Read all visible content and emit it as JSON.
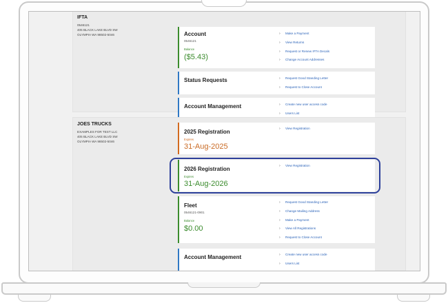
{
  "ifta": {
    "name": "IFTA",
    "lines": [
      "0546121",
      "405 BLACK LAKE BLVD SW",
      "OLYMPIA WA 98502-5046"
    ],
    "account": {
      "title": "Account",
      "number": "0546121",
      "balance_label": "Balance",
      "balance": "($5.43)",
      "links": [
        "Make a Payment",
        "View Returns",
        "Request or Renew IFTA Decals",
        "Change Account Addresses"
      ]
    },
    "status": {
      "title": "Status Requests",
      "links": [
        "Request Good Standing Letter",
        "Request to Close Account"
      ]
    },
    "management": {
      "title": "Account Management",
      "links": [
        "Create new user access code",
        "Users List"
      ]
    }
  },
  "joes": {
    "name": "JOES TRUCKS",
    "lines": [
      "EXAMPLES FOR TEST LLC",
      "405 BLACK LAKE BLVD SW",
      "OLYMPIA WA 98502-5046"
    ],
    "reg2025": {
      "title": "2025 Registration",
      "expires_label": "Expires",
      "date": "31-Aug-2025",
      "links": [
        "View Registration"
      ]
    },
    "reg2026": {
      "title": "2026 Registration",
      "expires_label": "Expires",
      "date": "31-Aug-2026",
      "links": [
        "View Registration"
      ]
    },
    "fleet": {
      "title": "Fleet",
      "number": "0546121-0901",
      "balance_label": "Balance",
      "balance": "$0.00",
      "links": [
        "Request Good Standing Letter",
        "Change Mailing Address",
        "Make a Payment",
        "View All Registrations",
        "Request to Close Account"
      ]
    },
    "management": {
      "title": "Account Management",
      "links": [
        "Create new user access code",
        "Users List"
      ]
    }
  },
  "colors": {
    "green": "#3a8b2c",
    "blue": "#2f78c4",
    "orange": "#d2691e",
    "highlight": "#2c3f9a",
    "link": "#2a62b8"
  },
  "icons": {
    "link_marker": "chevron-right-icon"
  }
}
